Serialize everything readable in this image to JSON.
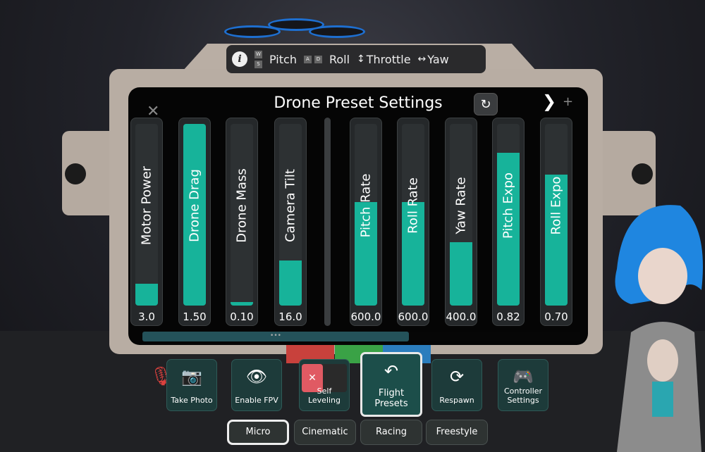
{
  "controls_hint": {
    "info_icon": "info-icon",
    "pitch_keys": [
      "W",
      "S"
    ],
    "pitch": "Pitch",
    "roll_keys": [
      "A",
      "D"
    ],
    "roll": "Roll",
    "throttle": "Throttle",
    "yaw": "Yaw"
  },
  "panel": {
    "title": "Drone Preset Settings",
    "next": "❯",
    "plus": "+",
    "close": "✕",
    "reset": "↻"
  },
  "sliders": [
    {
      "label": "Motor Power",
      "value": "3.0",
      "fill": 0.12
    },
    {
      "label": "Drone Drag",
      "value": "1.50",
      "fill": 1.0
    },
    {
      "label": "Drone Mass",
      "value": "0.10",
      "fill": 0.02
    },
    {
      "label": "Camera Tilt",
      "value": "16.0",
      "fill": 0.25
    },
    {
      "label": "Pitch Rate",
      "value": "600.0",
      "fill": 0.57
    },
    {
      "label": "Roll Rate",
      "value": "600.0",
      "fill": 0.57
    },
    {
      "label": "Yaw Rate",
      "value": "400.0",
      "fill": 0.35
    },
    {
      "label": "Pitch Expo",
      "value": "0.82",
      "fill": 0.84
    },
    {
      "label": "Roll Expo",
      "value": "0.70",
      "fill": 0.72
    }
  ],
  "scroll_handle": "•••",
  "actions": [
    {
      "label": "Take Photo",
      "icon": "📷"
    },
    {
      "label": "Enable FPV",
      "icon": "👁"
    },
    {
      "label": "Self Leveling",
      "icon": "✕"
    },
    {
      "label": "Flight Presets",
      "icon": "↶"
    },
    {
      "label": "Respawn",
      "icon": "⟳"
    },
    {
      "label": "Controller Settings",
      "icon": "🎮"
    }
  ],
  "presets": [
    "Micro",
    "Cinematic",
    "Racing",
    "Freestyle"
  ],
  "selected_preset": "Micro",
  "colors": {
    "accent": "#17b39a",
    "toggle_off": "#e05a63"
  }
}
